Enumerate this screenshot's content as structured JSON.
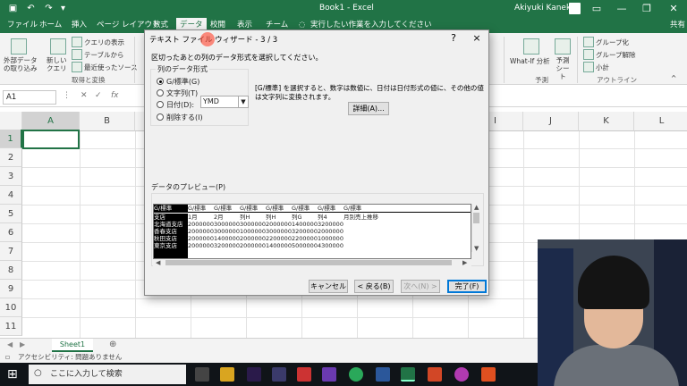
{
  "titlebar": {
    "doc_title": "Book1 - Excel",
    "user": "Akiyuki Kaneko"
  },
  "tabs": [
    "ファイル",
    "ホーム",
    "挿入",
    "ページ レイアウト",
    "数式",
    "データ",
    "校閲",
    "表示",
    "チーム"
  ],
  "tell_me": "実行したい作業を入力してください",
  "share": "共有",
  "ribbon": {
    "external_data": "外部データの取り込み",
    "new_query": "新しいクエリ",
    "show_queries": "クエリの表示",
    "from_table": "テーブルから",
    "recent_sources": "最近使ったソース",
    "group_get_transform": "取得と変換",
    "whatif": "What-If 分析",
    "forecast_sheet": "予測シート",
    "group_forecast": "予測",
    "group_btn": "グループ化",
    "ungroup_btn": "グループ解除",
    "subtotal": "小計",
    "group_outline": "アウトライン"
  },
  "namebox": "A1",
  "columns": [
    "A",
    "B",
    "C",
    "D",
    "E",
    "F",
    "G",
    "H",
    "I",
    "J",
    "K",
    "L"
  ],
  "rows": [
    "1",
    "2",
    "3",
    "4",
    "5",
    "6",
    "7",
    "8",
    "9",
    "10",
    "11"
  ],
  "sheet_tab": "Sheet1",
  "status": "アクセシビリティ: 問題ありません",
  "taskbar_search": "ここに入力して検索",
  "dialog": {
    "title": "テキスト ファイル ウィザード - 3 / 3",
    "help": "?",
    "close": "×",
    "instruction": "区切ったあとの列のデータ形式を選択してください。",
    "group_label": "列のデータ形式",
    "radio_general": "G/標準(G)",
    "radio_text": "文字列(T)",
    "radio_date": "日付(D):",
    "radio_skip": "削除する(I)",
    "date_format": "YMD",
    "description": "[G/標準] を選択すると、数字は数値に、日付は日付形式の値に、その他の値は文字列に変換されます。",
    "detail_button": "詳細(A)...",
    "preview_label": "データのプレビュー(P)",
    "cancel": "キャンセル",
    "back": "< 戻る(B)",
    "next": "次へ(N) >",
    "finish": "完了(F)"
  },
  "preview": {
    "header": [
      "G/標準",
      "G/標準",
      "G/標準",
      "G/標準",
      "G/標準",
      "G/標準",
      "G/標準",
      "G/標準"
    ],
    "rows": [
      [
        "支店",
        "1月",
        "2月",
        "列H",
        "列H",
        "列G",
        "列4",
        "月別売上推移"
      ],
      [
        "北海道支店",
        "2000000",
        "3000000",
        "3000000",
        "2000000",
        "1400000",
        "3200000",
        ""
      ],
      [
        "香春支店",
        "2000000",
        "3000000",
        "1000000",
        "3000000",
        "3200000",
        "2000000",
        ""
      ],
      [
        "秋田支店",
        "2000000",
        "1400000",
        "2000000",
        "2200000",
        "2200000",
        "1000000",
        ""
      ],
      [
        "東京支店",
        "2000000",
        "3200000",
        "2000000",
        "1400000",
        "5000000",
        "4300000",
        ""
      ]
    ]
  },
  "colors": {
    "excel_green": "#217346",
    "selection": "#000000"
  }
}
